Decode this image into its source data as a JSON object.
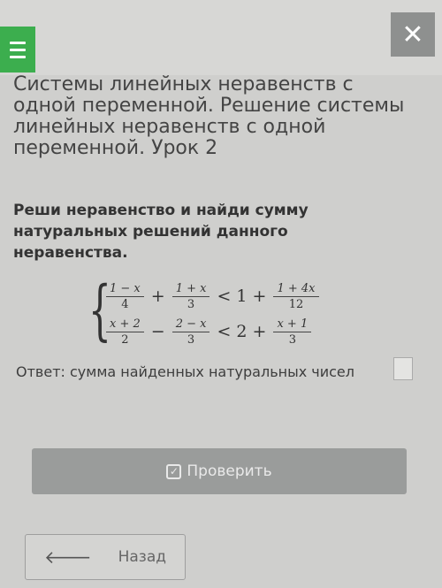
{
  "header": {
    "menu_icon": "hamburger-icon",
    "close_icon": "close-icon",
    "close_glyph": "✕"
  },
  "lesson": {
    "title": "Системы линейных неравенств с одной переменной. Решение системы линейных неравенств с одной переменной. Урок 2"
  },
  "task": {
    "prompt": "Реши неравенство и найди сумму натуральных решений данного неравенства."
  },
  "system": {
    "row1": {
      "frac1_num": "1 − x",
      "frac1_den": "4",
      "op1": "+",
      "frac2_num": "1 + x",
      "frac2_den": "3",
      "rel": "< 1 +",
      "frac3_num": "1 + 4x",
      "frac3_den": "12"
    },
    "row2": {
      "frac1_num": "x + 2",
      "frac1_den": "2",
      "op1": "−",
      "frac2_num": "2 − x",
      "frac2_den": "3",
      "rel": "< 2 +",
      "frac3_num": "x + 1",
      "frac3_den": "3"
    }
  },
  "answer": {
    "label": "Ответ: сумма найденных натуральных чисел",
    "value": ""
  },
  "buttons": {
    "check_label": "Проверить",
    "check_icon": "checkbox-icon",
    "back_label": "Назад",
    "back_icon": "arrow-left-icon",
    "back_glyph": "🡐"
  }
}
